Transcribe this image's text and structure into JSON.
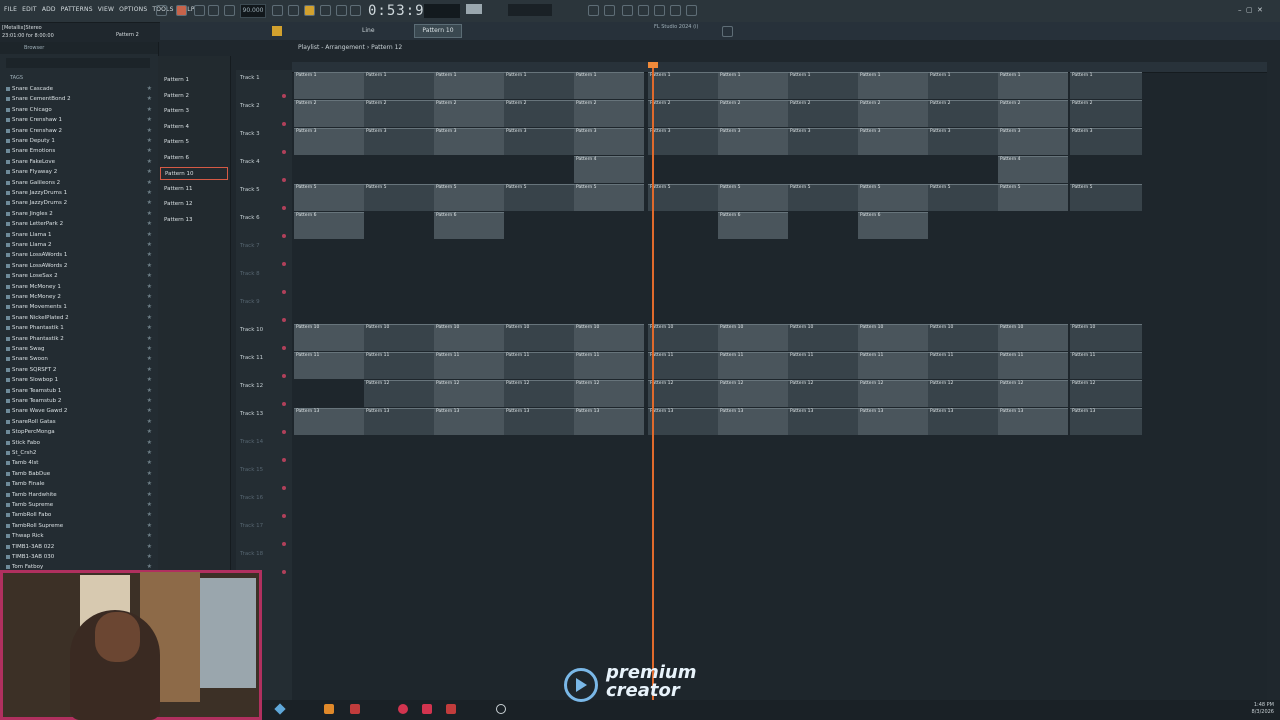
{
  "menu": [
    "FILE",
    "EDIT",
    "ADD",
    "PATTERNS",
    "VIEW",
    "OPTIONS",
    "TOOLS",
    "HELP"
  ],
  "bpm": "90.000",
  "time": "0:53:97",
  "status": {
    "line1": "[Metallix]Stereo",
    "line2": "23:01:00 for 8:00:00",
    "pattern_label": "Pattern 2"
  },
  "pattern_selector": "Pattern 10",
  "playlist_title": "Playlist - Arrangement › Pattern 12",
  "snap_label": "Line",
  "fl_label": "FL Studio 2024 (i)",
  "browser_tab": "Browser",
  "tags": "TAGS",
  "browser_items": [
    "Snare Cascade",
    "Snare CementBond 2",
    "Snare Chicago",
    "Snare Crenshaw 1",
    "Snare Crenshaw 2",
    "Snare Deputy 1",
    "Snare Emotions",
    "Snare FakeLove",
    "Snare Flyaway 2",
    "Snare Galileons 2",
    "Snare JazzyDrums 1",
    "Snare JazzyDrums 2",
    "Snare Jingles 2",
    "Snare LetterPark 2",
    "Snare Llama 1",
    "Snare Llama 2",
    "Snare LossAWords 1",
    "Snare LossAWords 2",
    "Snare LoseSax 2",
    "Snare McMoney 1",
    "Snare McMoney 2",
    "Snare Movements 1",
    "Snare NickelPlated 2",
    "Snare Phantastik 1",
    "Snare Phantastik 2",
    "Snare Swag",
    "Snare Swoon",
    "Snare SQRSFT 2",
    "Snare Slowbop 1",
    "Snare Teamstub 1",
    "Snare Teamstub 2",
    "Snare Wave Gawd 2",
    "SnareRoll Gatas",
    "StopPercMonga",
    "Stick Fabo",
    "St_Crsh2",
    "Tamb 4lst",
    "Tamb BabDue",
    "Tamb Finale",
    "Tamb Hardwhite",
    "Tamb Supreme",
    "TambRoll Fabo",
    "TambRoll Supreme",
    "Thwap Rick",
    "TIMB1-3AB 022",
    "TIMB1-3AB 030",
    "Tom Fatboy"
  ],
  "patterns": [
    "Pattern 1",
    "Pattern 2",
    "Pattern 3",
    "Pattern 4",
    "Pattern 5",
    "Pattern 6",
    "Pattern 10",
    "Pattern 11",
    "Pattern 12",
    "Pattern 13"
  ],
  "selected_pattern": "Pattern 10",
  "tracks": [
    "Track 1",
    "Track 2",
    "Track 3",
    "Track 4",
    "Track 5",
    "Track 6",
    "Track 7",
    "Track 8",
    "Track 9",
    "Track 10",
    "Track 11",
    "Track 12",
    "Track 13",
    "Track 14",
    "Track 15",
    "Track 16",
    "Track 17",
    "Track 18"
  ],
  "clips": [
    {
      "row": 0,
      "label": "Pattern 1"
    },
    {
      "row": 1,
      "label": "Pattern 2"
    },
    {
      "row": 2,
      "label": "Pattern 3"
    },
    {
      "row": 3,
      "label": "Pattern 4"
    },
    {
      "row": 4,
      "label": "Pattern 5"
    },
    {
      "row": 5,
      "label": "Pattern 6"
    },
    {
      "row": 9,
      "label": "Pattern 10"
    },
    {
      "row": 10,
      "label": "Pattern 11"
    },
    {
      "row": 11,
      "label": "Pattern 12"
    },
    {
      "row": 12,
      "label": "Pattern 13"
    }
  ],
  "brand": {
    "line1": "premium",
    "line2": "creator"
  },
  "tray": {
    "time": "1:48 PM",
    "date": "8/3/2026"
  },
  "colors": {
    "accent": "#e06a2c",
    "selected": "#d65a45",
    "webcam_border": "#b0305f",
    "logo": "#7ab8e8"
  }
}
